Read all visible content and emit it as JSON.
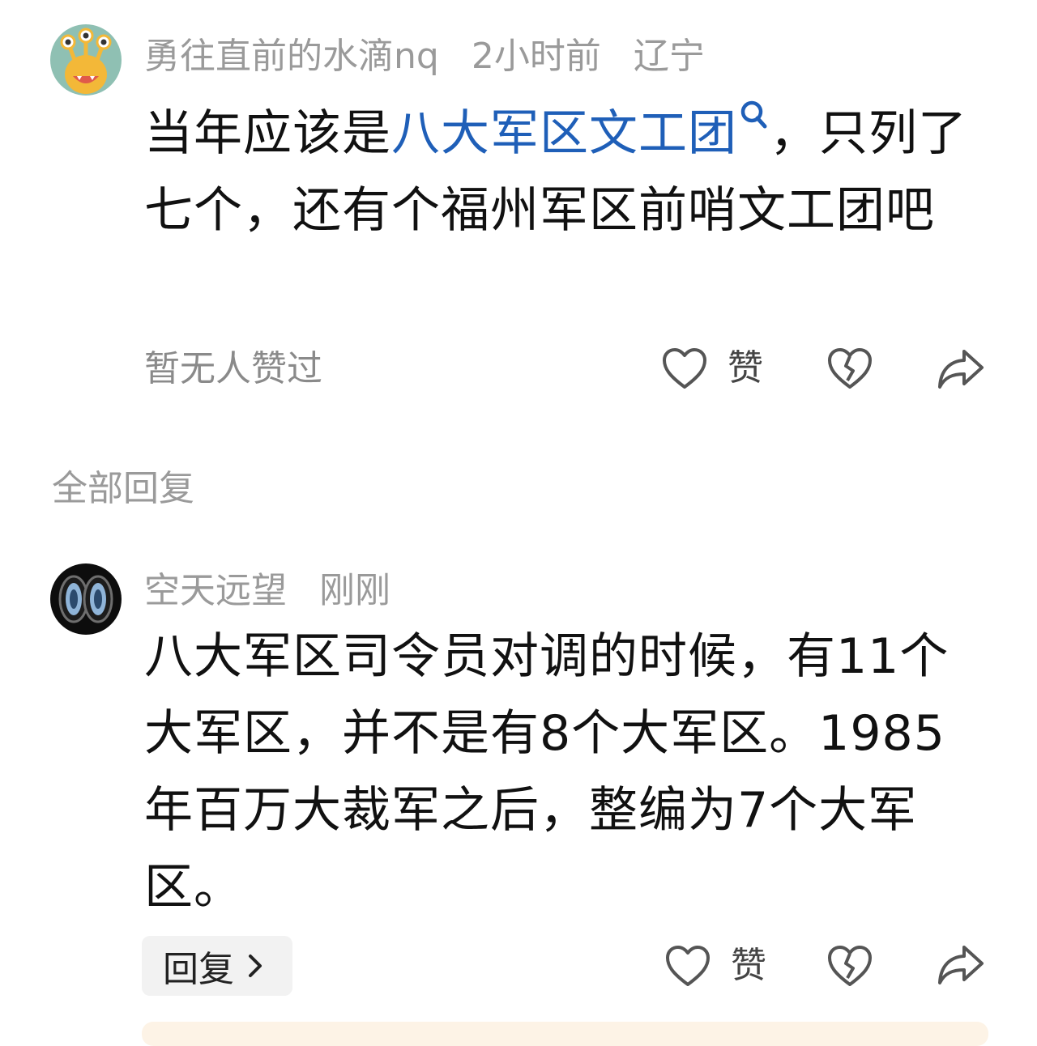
{
  "comment": {
    "username": "勇往直前的水滴nq",
    "time": "2小时前",
    "location": "辽宁",
    "text_before": "当年应该是",
    "keyword": "八大军区文工团",
    "text_after": "，只列了七个，还有个福州军区前哨文工团吧",
    "likes_status": "暂无人赞过",
    "like_label": "赞",
    "avatar_icon": "monster-avatar-icon"
  },
  "section_title": "全部回复",
  "reply": {
    "username": "空天远望",
    "time": "刚刚",
    "text": "八大军区司令员对调的时候，有11个大军区，并不是有8个大军区。1985年百万大裁军之后，整编为7个大军区。",
    "reply_button_label": "回复",
    "like_label": "赞",
    "avatar_icon": "goggles-avatar-icon"
  },
  "colors": {
    "keyword": "#1f5fb8",
    "meta_text": "#9a9a9a",
    "icon_stroke": "#555555"
  }
}
